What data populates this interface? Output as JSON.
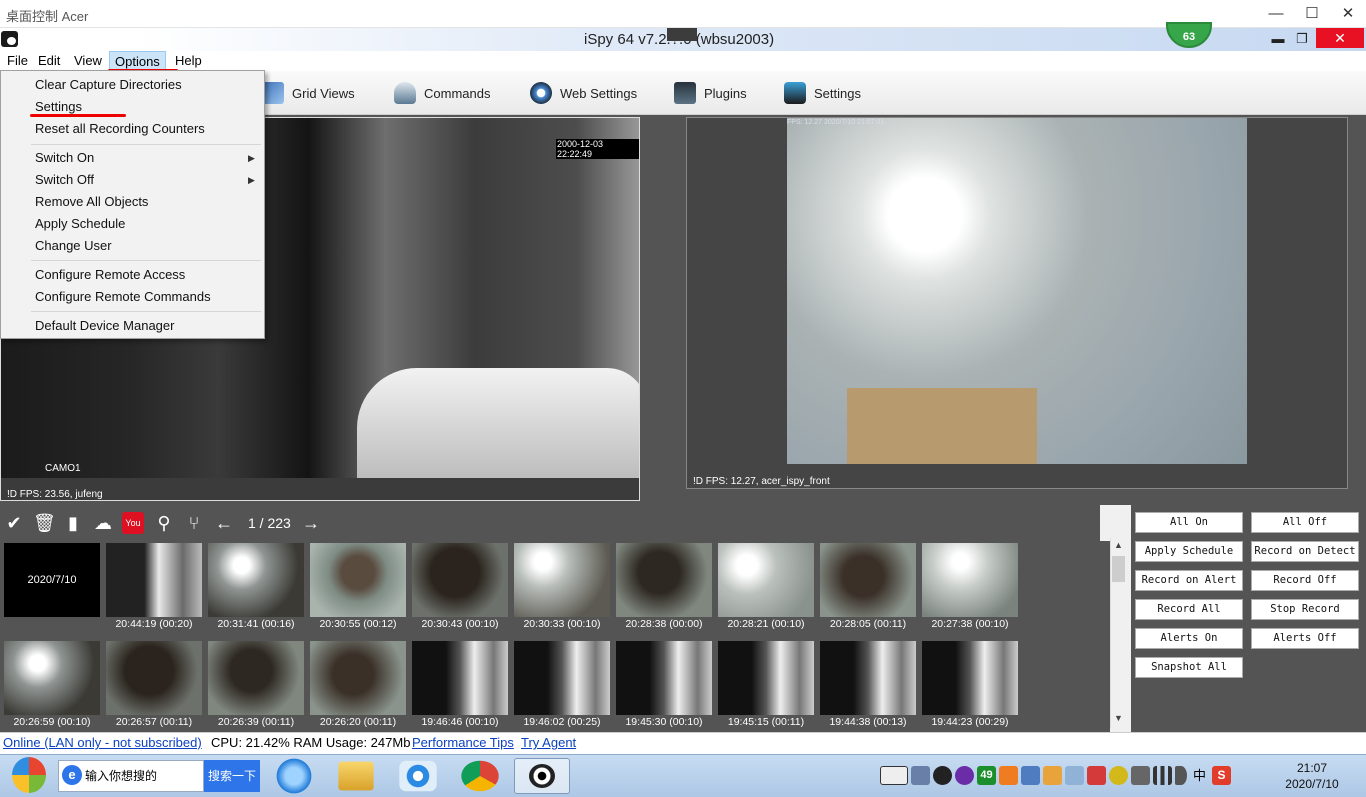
{
  "remote_desktop": {
    "title": "桌面控制   Acer",
    "minimize": "—",
    "maximize": "☐",
    "close": "✕"
  },
  "window": {
    "title": "iSpy 64 v7.2.?.0 (wbsu2003)",
    "badge": "63"
  },
  "menu": [
    "File",
    "Edit",
    "View",
    "Options",
    "Help"
  ],
  "toolbar": [
    {
      "label": "Grid Views",
      "icon": "grid-views-icon"
    },
    {
      "label": "Commands",
      "icon": "commands-icon"
    },
    {
      "label": "Web Settings",
      "icon": "web-settings-icon"
    },
    {
      "label": "Plugins",
      "icon": "plugins-icon"
    },
    {
      "label": "Settings",
      "icon": "settings-icon"
    }
  ],
  "options_menu": {
    "items": [
      "Clear Capture Directories",
      "Settings",
      "Reset all Recording Counters",
      "Switch On",
      "Switch Off",
      "Remove All Objects",
      "Apply Schedule",
      "Change User",
      "Configure Remote Access",
      "Configure Remote Commands",
      "Default Device Manager"
    ]
  },
  "cameras": [
    {
      "timestamp": "2000-12-03 22:22:49",
      "name": "CAMO1",
      "status": "!D  FPS: 23.56, jufeng"
    },
    {
      "timestamp": "FPS: 12.27 2020/7/10 21:07:01",
      "status": "!D  FPS: 12.27, acer_ispy_front"
    }
  ],
  "thumb_toolbar": {
    "page": "1 / 223"
  },
  "thumbnails": {
    "date": "2020/7/10",
    "row1": [
      "20:44:19 (00:20)",
      "20:31:41 (00:16)",
      "20:30:55 (00:12)",
      "20:30:43 (00:10)",
      "20:30:33 (00:10)",
      "20:28:38 (00:00)",
      "20:28:21 (00:10)",
      "20:28:05 (00:11)",
      "20:27:38 (00:10)"
    ],
    "row2": [
      "20:26:59 (00:10)",
      "20:26:57 (00:11)",
      "20:26:39 (00:11)",
      "20:26:20 (00:11)",
      "19:46:46 (00:10)",
      "19:46:02 (00:25)",
      "19:45:30 (00:10)",
      "19:45:15 (00:11)",
      "19:44:38 (00:13)",
      "19:44:23 (00:29)"
    ]
  },
  "actions": [
    "All On",
    "All Off",
    "Apply Schedule",
    "Record on Detect",
    "Record on Alert",
    "Record Off",
    "Record All",
    "Stop Record",
    "Alerts On",
    "Alerts Off",
    "Snapshot All"
  ],
  "status": {
    "online": "Online (LAN only - not subscribed)",
    "usage": "CPU: 21.42% RAM Usage: 247Mb",
    "tips": "Performance Tips",
    "agent": "Try Agent"
  },
  "taskbar": {
    "search_placeholder": "输入你想搜的",
    "search_button": "搜索一下",
    "tray_badge": "49",
    "ime": "中",
    "time": "21:07",
    "date": "2020/7/10"
  }
}
